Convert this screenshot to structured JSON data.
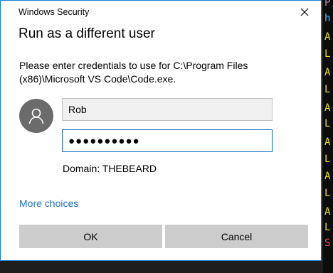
{
  "dialog": {
    "window_title": "Windows Security",
    "heading": "Run as a different user",
    "message": "Please enter credentials to use for C:\\Program Files (x86)\\Microsoft VS Code\\Code.exe.",
    "username_value": "Rob",
    "password_mask": "●●●●●●●●●●",
    "domain_text": "Domain: THEBEARD",
    "more_choices_label": "More choices",
    "ok_label": "OK",
    "cancel_label": "Cancel"
  },
  "icons": {
    "close": "close-icon",
    "avatar": "user-avatar-icon"
  },
  "colors": {
    "accent_border": "#1d7bd1",
    "link": "#1f73cc",
    "button_bg": "#cccccc",
    "avatar_bg": "#6b6b6b"
  },
  "background_strip": [
    {
      "text": "P",
      "color": "#b48ead"
    },
    {
      "text": "h",
      "color": "#4fc1ff"
    },
    {
      "text": "A",
      "color": "#e5e510"
    },
    {
      "text": "L",
      "color": "#e5e510"
    },
    {
      "text": "A",
      "color": "#e5e510"
    },
    {
      "text": "L",
      "color": "#e5e510"
    },
    {
      "text": "A",
      "color": "#e5e510"
    },
    {
      "text": "L",
      "color": "#e5e510"
    },
    {
      "text": "A",
      "color": "#e5e510"
    },
    {
      "text": "L",
      "color": "#e5e510"
    },
    {
      "text": "A",
      "color": "#e5e510"
    },
    {
      "text": "L",
      "color": "#e5e510"
    },
    {
      "text": "A",
      "color": "#e5e510"
    },
    {
      "text": "L",
      "color": "#e5e510"
    },
    {
      "text": "S",
      "color": "#f14c4c"
    }
  ]
}
